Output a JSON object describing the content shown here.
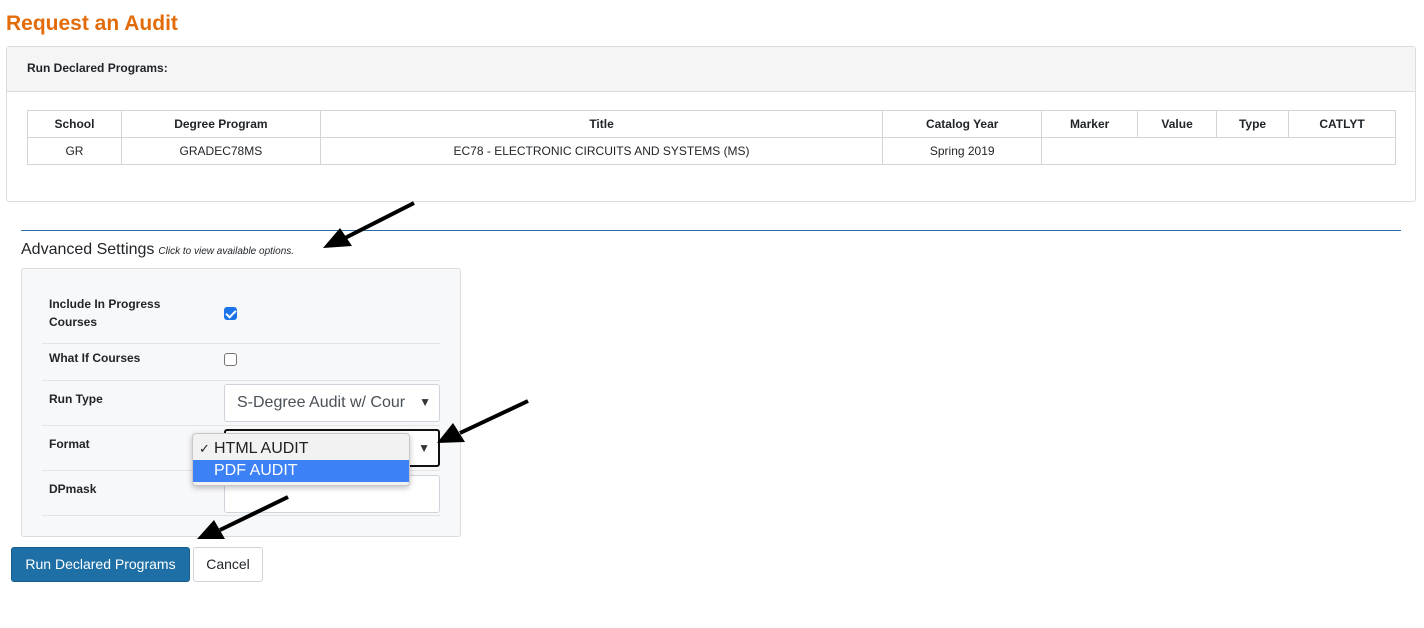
{
  "page": {
    "title": "Request an Audit"
  },
  "declared": {
    "header": "Run Declared Programs:",
    "columns": [
      "School",
      "Degree Program",
      "Title",
      "Catalog Year",
      "Marker",
      "Value",
      "Type",
      "CATLYT"
    ],
    "rows": [
      [
        "GR",
        "GRADEC78MS",
        "EC78 - ELECTRONIC CIRCUITS AND SYSTEMS (MS)",
        "Spring 2019",
        "",
        "",
        "",
        ""
      ]
    ]
  },
  "advanced": {
    "title": "Advanced Settings",
    "hint": "Click to view available options.",
    "include_in_progress": {
      "label": "Include In Progress Courses",
      "checked": true
    },
    "what_if": {
      "label": "What If Courses",
      "checked": false
    },
    "run_type": {
      "label": "Run Type",
      "value": "S-Degree Audit w/ Cour"
    },
    "format": {
      "label": "Format",
      "options": [
        "HTML AUDIT",
        "PDF AUDIT"
      ],
      "selected": "HTML AUDIT",
      "highlighted": "PDF AUDIT"
    },
    "dpmask": {
      "label": "DPmask",
      "value": ""
    }
  },
  "buttons": {
    "run": "Run Declared Programs",
    "cancel": "Cancel"
  },
  "colors": {
    "title": "#e36c0a",
    "primary": "#1d6fa5",
    "highlight": "#3c82f6",
    "divider": "#2c6fa6"
  }
}
